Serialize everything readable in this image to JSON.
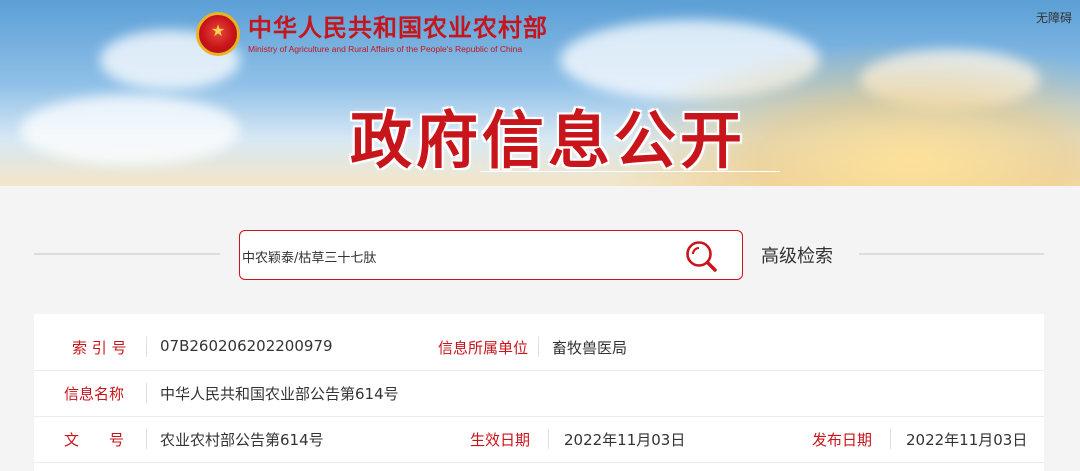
{
  "header": {
    "ministry_cn": "中华人民共和国农业农村部",
    "ministry_en": "Ministry of Agriculture and Rural Affairs of the People's Republic of China",
    "accessibility_label": "无障碍",
    "banner_title": "政府信息公开"
  },
  "search": {
    "value": "中农颖泰/枯草三十七肽",
    "advanced_label": "高级检索"
  },
  "info": {
    "index_label": "索 引 号",
    "index_value": "07B260206202200979",
    "unit_label": "信息所属单位",
    "unit_value": "畜牧兽医局",
    "name_label": "信息名称",
    "name_value": "中华人民共和国农业部公告第614号",
    "doc_label": "文　　号",
    "doc_value": "农业农村部公告第614号",
    "effective_label": "生效日期",
    "effective_value": "2022年11月03日",
    "publish_label": "发布日期",
    "publish_value": "2022年11月03日"
  },
  "colors": {
    "accent": "#c8141b",
    "label_red": "#c8141b"
  },
  "icons": {
    "search": "search-icon",
    "emblem": "national-emblem-icon"
  }
}
